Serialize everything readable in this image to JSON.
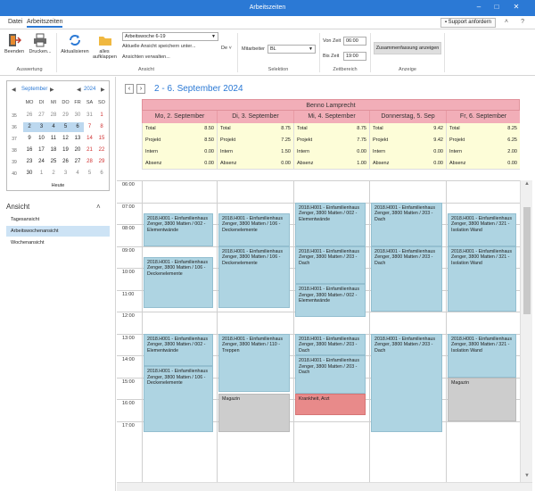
{
  "window": {
    "title": "Arbeitszeiten"
  },
  "menu": {
    "tabs": [
      "Datei",
      "Arbeitszeiten"
    ],
    "support_label": "Support anfordern"
  },
  "ribbon": {
    "beenden": "Beenden",
    "drucken": "Drucken...",
    "aktualisieren": "Aktualisieren",
    "alles_aufklappen": "alles aufklappen",
    "view_combo": "Arbeitswoche 6-19",
    "save_view": "Aktuelle Ansicht speichern unter...",
    "manage_views": "Ansichten verwalten...",
    "de_label": "De",
    "mitarbeiter_label": "Mitarbeiter",
    "mitarbeiter_value": "BL",
    "von_label": "Von Zeit",
    "von_value": "06:00",
    "bis_label": "Bis Zeit",
    "bis_value": "19:00",
    "summary_button": "Zusammenfassung anzeigen",
    "groups": [
      "Auswertung",
      "Ansicht",
      "Selektion",
      "Zeitbereich",
      "Anzeige"
    ]
  },
  "calendar": {
    "month": "September",
    "year": "2024",
    "weekdays": [
      "MO",
      "DI",
      "MI",
      "DO",
      "FR",
      "SA",
      "SO"
    ],
    "weeks": [
      {
        "kw": "35",
        "days": [
          "26",
          "27",
          "28",
          "29",
          "30",
          "31",
          "1"
        ]
      },
      {
        "kw": "36",
        "days": [
          "2",
          "3",
          "4",
          "5",
          "6",
          "7",
          "8"
        ]
      },
      {
        "kw": "37",
        "days": [
          "9",
          "10",
          "11",
          "12",
          "13",
          "14",
          "15"
        ]
      },
      {
        "kw": "38",
        "days": [
          "16",
          "17",
          "18",
          "19",
          "20",
          "21",
          "22"
        ]
      },
      {
        "kw": "39",
        "days": [
          "23",
          "24",
          "25",
          "26",
          "27",
          "28",
          "29"
        ]
      },
      {
        "kw": "40",
        "days": [
          "30",
          "1",
          "2",
          "3",
          "4",
          "5",
          "6"
        ]
      }
    ],
    "today_label": "Heute"
  },
  "views": {
    "header": "Ansicht",
    "items": [
      "Tagesansicht",
      "Arbeitswochenansicht",
      "Wochenansicht"
    ]
  },
  "schedule": {
    "range_title": "2 - 6. September 2024",
    "resource": "Benno Lamprecht",
    "days": [
      {
        "title": "Mo, 2. September",
        "summary": [
          [
            "Total",
            "8.50"
          ],
          [
            "Projekt",
            "8.50"
          ],
          [
            "Intern",
            "0.00"
          ],
          [
            "Absenz",
            "0.00"
          ]
        ]
      },
      {
        "title": "Di, 3. September",
        "summary": [
          [
            "Total",
            "8.75"
          ],
          [
            "Projekt",
            "7.25"
          ],
          [
            "Intern",
            "1.50"
          ],
          [
            "Absenz",
            "0.00"
          ]
        ]
      },
      {
        "title": "Mi, 4. September",
        "summary": [
          [
            "Total",
            "8.75"
          ],
          [
            "Projekt",
            "7.75"
          ],
          [
            "Intern",
            "0.00"
          ],
          [
            "Absenz",
            "1.00"
          ]
        ]
      },
      {
        "title": "Donnerstag, 5. Sep",
        "summary": [
          [
            "Total",
            "9.42"
          ],
          [
            "Projekt",
            "9.42"
          ],
          [
            "Intern",
            "0.00"
          ],
          [
            "Absenz",
            "0.00"
          ]
        ]
      },
      {
        "title": "Fr, 6. September",
        "summary": [
          [
            "Total",
            "8.25"
          ],
          [
            "Projekt",
            "6.25"
          ],
          [
            "Intern",
            "2.00"
          ],
          [
            "Absenz",
            "0.00"
          ]
        ]
      }
    ],
    "hours": [
      "06:00",
      "07:00",
      "08:00",
      "09:00",
      "10:00",
      "11:00",
      "12:00",
      "13:00",
      "14:00",
      "15:00",
      "16:00",
      "17:00"
    ],
    "events": {
      "mo1": "2018.H001 - Einfamilienhaus Zenger, 3800 Matten / 002 - Elementwände",
      "mo2": "2018.H001 - Einfamilienhaus Zenger, 3800 Matten / 106 - Deckenelemente",
      "mo3": "2018.H001 - Einfamilienhaus Zenger, 3800 Matten / 002 - Elementwände",
      "mo4": "2018.H001 - Einfamilienhaus Zenger, 3800 Matten / 106 - Deckenelemente",
      "di1": "2018.H001 - Einfamilienhaus Zenger, 3800 Matten / 106 - Deckenelemente",
      "di2": "2018.H001 - Einfamilienhaus Zenger, 3800 Matten / 106 - Deckenelemente",
      "di3": "2018.H001 - Einfamilienhaus Zenger, 3800 Matten / 110 - Treppen",
      "di4": "Magazin",
      "mi1": "2018.H001 - Einfamilienhaus Zenger, 3800 Matten / 002 - Elementwände",
      "mi2": "2018.H001 - Einfamilienhaus Zenger, 3800 Matten / 203 - Dach",
      "mi3": "2018.H001 - Einfamilienhaus Zenger, 3800 Matten / 002 - Elementwände",
      "mi4": "2018.H001 - Einfamilienhaus Zenger, 3800 Matten / 203 - Dach",
      "mi5": "2018.H001 - Einfamilienhaus Zenger, 3800 Matten / 203 - Dach",
      "mi6": "Krankheit, Arzt",
      "do1": "2018.H001 - Einfamilienhaus Zenger, 3800 Matten / 203 - Dach",
      "do2": "2018.H001 - Einfamilienhaus Zenger, 3800 Matten / 203 - Dach",
      "do3": "2018.H001 - Einfamilienhaus Zenger, 3800 Matten / 203 - Dach",
      "fr1": "2018.H001 - Einfamilienhaus Zenger, 3800 Matten / 321 - Isolation Wand",
      "fr2": "2018.H001 - Einfamilienhaus Zenger, 3800 Matten / 321 - Isolation Wand",
      "fr3": "2018.H001 - Einfamilienhaus Zenger, 3800 Matten / 321 - Isolation Wand",
      "fr4": "Magazin"
    }
  },
  "colors": {
    "accent": "#2b79d5",
    "header_pink": "#f2aeb8",
    "summary_yellow": "#fdfdd8",
    "event_blue": "#aed4e2",
    "event_gray": "#cdcdcd",
    "event_red": "#e88a8a"
  }
}
